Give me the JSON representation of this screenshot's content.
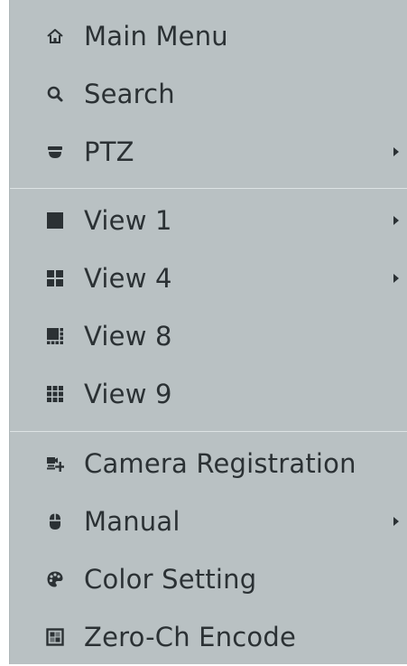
{
  "menu": {
    "items": [
      {
        "label": "Main Menu",
        "icon": "home-icon"
      },
      {
        "label": "Search",
        "icon": "search-icon"
      },
      {
        "label": "PTZ",
        "icon": "dome-camera-icon",
        "submenu": true
      },
      {
        "label": "View 1",
        "icon": "single-view-icon",
        "submenu": true
      },
      {
        "label": "View 4",
        "icon": "quad-view-icon",
        "submenu": true
      },
      {
        "label": "View 8",
        "icon": "eight-view-icon"
      },
      {
        "label": "View 9",
        "icon": "nine-view-icon"
      },
      {
        "label": "Camera Registration",
        "icon": "camera-registration-icon"
      },
      {
        "label": "Manual",
        "icon": "mouse-icon",
        "submenu": true
      },
      {
        "label": "Color Setting",
        "icon": "palette-icon"
      },
      {
        "label": "Zero-Ch Encode",
        "icon": "zero-channel-icon"
      }
    ]
  },
  "colors": {
    "background": "#b9c1c3",
    "text": "#2b3134",
    "divider": "#dde3e4"
  }
}
